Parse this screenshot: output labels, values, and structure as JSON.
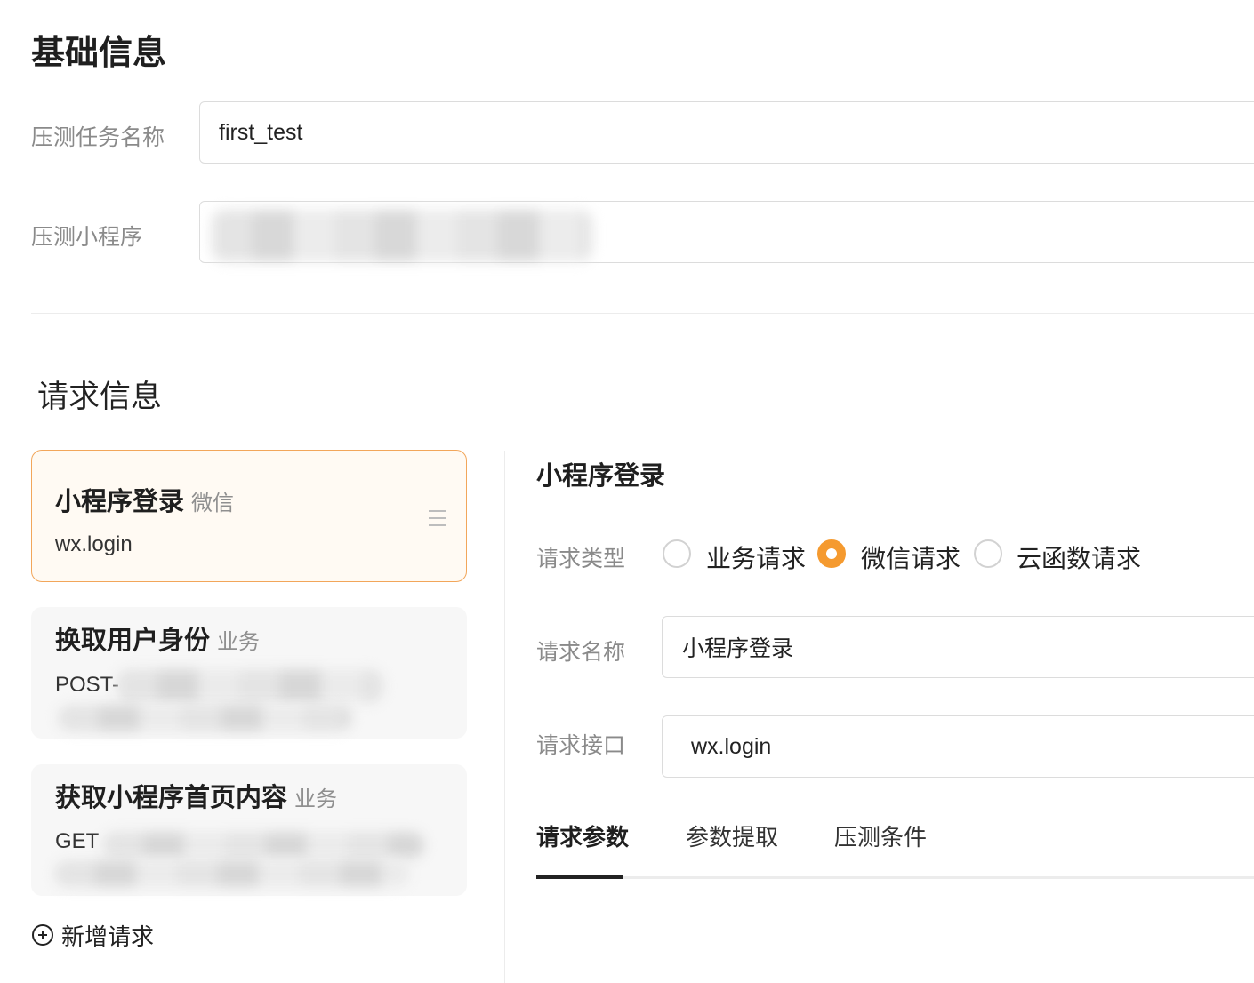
{
  "basic_info": {
    "title": "基础信息",
    "task_name_label": "压测任务名称",
    "task_name_value": "first_test",
    "miniprogram_label": "压测小程序"
  },
  "request_info": {
    "title": "请求信息",
    "requests": [
      {
        "title": "小程序登录",
        "tag": "微信",
        "sub": "wx.login"
      },
      {
        "title": "换取用户身份",
        "tag": "业务",
        "sub": "POST-"
      },
      {
        "title": "获取小程序首页内容",
        "tag": "业务",
        "sub": "GET"
      }
    ],
    "add_request_label": "新增请求"
  },
  "detail": {
    "title": "小程序登录",
    "type_label": "请求类型",
    "type_options": [
      "业务请求",
      "微信请求",
      "云函数请求"
    ],
    "selected_type": "微信请求",
    "name_label": "请求名称",
    "name_value": "小程序登录",
    "api_label": "请求接口",
    "api_value": "wx.login",
    "tabs": [
      "请求参数",
      "参数提取",
      "压测条件"
    ],
    "active_tab": "请求参数"
  },
  "colors": {
    "accent": "#f59a2f",
    "active_card_border": "#f2a65a",
    "active_card_bg": "#fffaf3"
  }
}
